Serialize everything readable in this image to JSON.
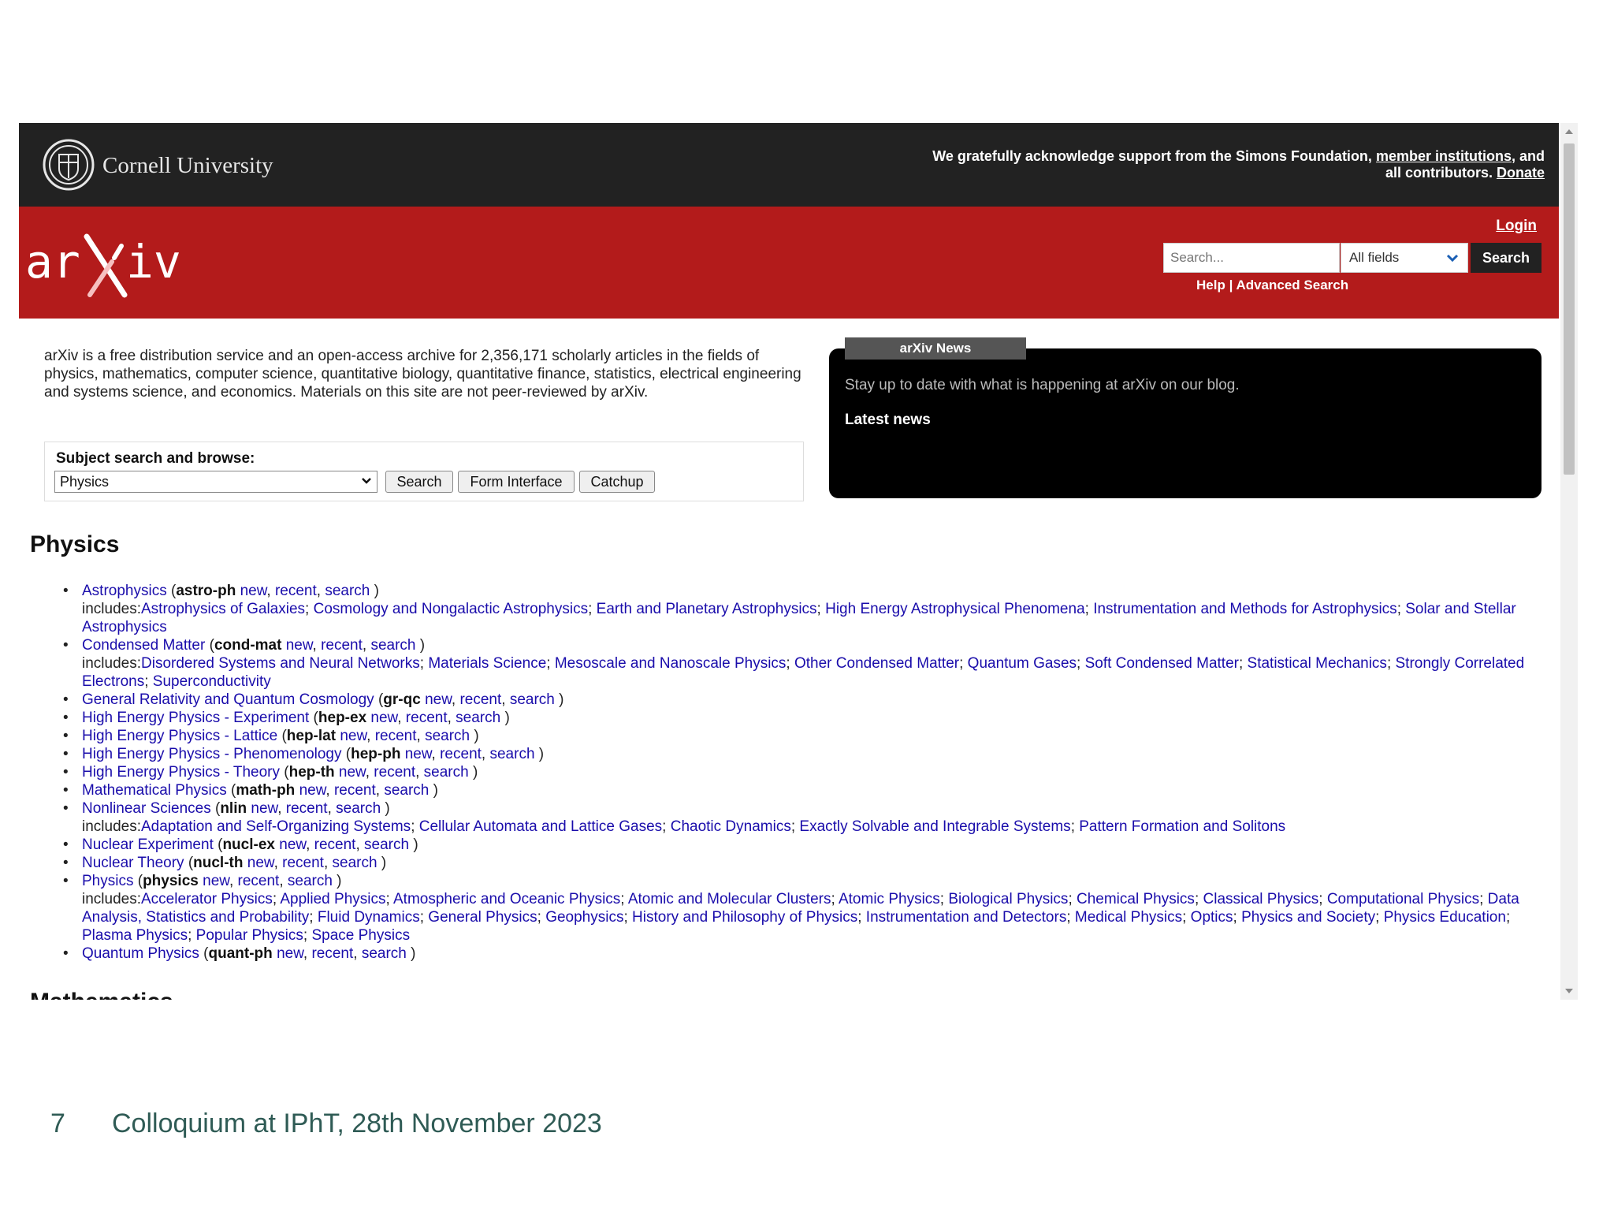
{
  "cornell": {
    "name": "Cornell University",
    "support_prefix": "We gratefully acknowledge support from the Simons Foundation,",
    "member_link": "member institutions",
    "support_mid": ", and all contributors.",
    "donate_link": "Donate"
  },
  "header": {
    "login": "Login",
    "search_placeholder": "Search...",
    "field_selected": "All fields",
    "search_button": "Search",
    "help": "Help",
    "separator": "|",
    "advanced": "Advanced Search",
    "colors": {
      "banner": "#222222",
      "arxiv_red": "#b31b1b"
    }
  },
  "intro": {
    "text": "arXiv is a free distribution service and an open-access archive for 2,356,171 scholarly articles in the fields of physics, mathematics, computer science, quantitative biology, quantitative finance, statistics, electrical engineering and systems science, and economics. Materials on this site are not peer-reviewed by arXiv."
  },
  "subject": {
    "title": "Subject search and browse:",
    "selected": "Physics",
    "search_button": "Search",
    "form_button": "Form Interface",
    "catchup_button": "Catchup"
  },
  "news": {
    "tab": "arXiv News",
    "blurb": "Stay up to date with what is happening at arXiv on our blog.",
    "latest": "Latest news"
  },
  "section": {
    "title": "Physics",
    "cut_heading": "Mathematics"
  },
  "archives": [
    {
      "name": "Astrophysics",
      "code": "astro-ph",
      "includes": [
        "Astrophysics of Galaxies",
        "Cosmology and Nongalactic Astrophysics",
        "Earth and Planetary Astrophysics",
        "High Energy Astrophysical Phenomena",
        "Instrumentation and Methods for Astrophysics",
        "Solar and Stellar Astrophysics"
      ]
    },
    {
      "name": "Condensed Matter",
      "code": "cond-mat",
      "includes": [
        "Disordered Systems and Neural Networks",
        "Materials Science",
        "Mesoscale and Nanoscale Physics",
        "Other Condensed Matter",
        "Quantum Gases",
        "Soft Condensed Matter",
        "Statistical Mechanics",
        "Strongly Correlated Electrons",
        "Superconductivity"
      ]
    },
    {
      "name": "General Relativity and Quantum Cosmology",
      "code": "gr-qc",
      "includes": []
    },
    {
      "name": "High Energy Physics - Experiment",
      "code": "hep-ex",
      "includes": []
    },
    {
      "name": "High Energy Physics - Lattice",
      "code": "hep-lat",
      "includes": []
    },
    {
      "name": "High Energy Physics - Phenomenology",
      "code": "hep-ph",
      "includes": []
    },
    {
      "name": "High Energy Physics - Theory",
      "code": "hep-th",
      "includes": []
    },
    {
      "name": "Mathematical Physics",
      "code": "math-ph",
      "includes": []
    },
    {
      "name": "Nonlinear Sciences",
      "code": "nlin",
      "includes": [
        "Adaptation and Self-Organizing Systems",
        "Cellular Automata and Lattice Gases",
        "Chaotic Dynamics",
        "Exactly Solvable and Integrable Systems",
        "Pattern Formation and Solitons"
      ]
    },
    {
      "name": "Nuclear Experiment",
      "code": "nucl-ex",
      "includes": []
    },
    {
      "name": "Nuclear Theory",
      "code": "nucl-th",
      "includes": []
    },
    {
      "name": "Physics",
      "code": "physics",
      "includes": [
        "Accelerator Physics",
        "Applied Physics",
        "Atmospheric and Oceanic Physics",
        "Atomic and Molecular Clusters",
        "Atomic Physics",
        "Biological Physics",
        "Chemical Physics",
        "Classical Physics",
        "Computational Physics",
        "Data Analysis, Statistics and Probability",
        "Fluid Dynamics",
        "General Physics",
        "Geophysics",
        "History and Philosophy of Physics",
        "Instrumentation and Detectors",
        "Medical Physics",
        "Optics",
        "Physics and Society",
        "Physics Education",
        "Plasma Physics",
        "Popular Physics",
        "Space Physics"
      ]
    },
    {
      "name": "Quantum Physics",
      "code": "quant-ph",
      "includes": []
    }
  ],
  "labels": {
    "new": "new",
    "recent": "recent",
    "search": "search",
    "includes": "includes:"
  },
  "footer": {
    "page_number": "7",
    "title": "Colloquium at IPhT, 28th November 2023"
  }
}
